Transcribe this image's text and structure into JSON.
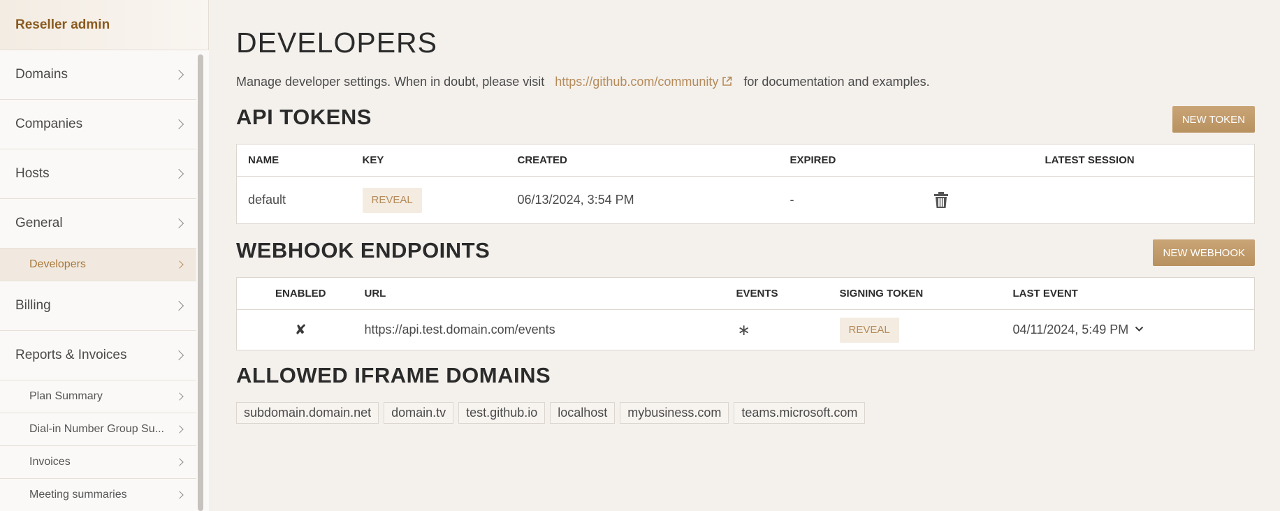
{
  "sidebar": {
    "header": "Reseller admin",
    "items": [
      {
        "label": "Domains"
      },
      {
        "label": "Companies"
      },
      {
        "label": "Hosts"
      },
      {
        "label": "General"
      },
      {
        "label": "Developers"
      },
      {
        "label": "Billing"
      },
      {
        "label": "Reports & Invoices"
      },
      {
        "label": "Plan Summary"
      },
      {
        "label": "Dial-in Number Group Su..."
      },
      {
        "label": "Invoices"
      },
      {
        "label": "Meeting summaries"
      }
    ]
  },
  "page": {
    "title": "DEVELOPERS",
    "intro_prefix": "Manage developer settings. When in doubt, please visit",
    "intro_link": "https://github.com/community",
    "intro_suffix": "for documentation and examples."
  },
  "api_tokens": {
    "title": "API TOKENS",
    "new_button": "NEW TOKEN",
    "columns": [
      "NAME",
      "KEY",
      "CREATED",
      "EXPIRED",
      "LATEST SESSION"
    ],
    "rows": [
      {
        "name": "default",
        "key": "REVEAL",
        "created": "06/13/2024, 3:54 PM",
        "expired": "-",
        "latest_session": ""
      }
    ]
  },
  "webhooks": {
    "title": "WEBHOOK ENDPOINTS",
    "new_button": "NEW WEBHOOK",
    "columns": [
      "ENABLED",
      "URL",
      "EVENTS",
      "SIGNING TOKEN",
      "LAST EVENT"
    ],
    "rows": [
      {
        "enabled": "✘",
        "url": "https://api.test.domain.com/events",
        "events": "∗",
        "signing_token": "REVEAL",
        "last_event": "04/11/2024, 5:49 PM"
      }
    ]
  },
  "iframe": {
    "title": "ALLOWED IFRAME DOMAINS",
    "domains": [
      "subdomain.domain.net",
      "domain.tv",
      "test.github.io",
      "localhost",
      "mybusiness.com",
      "teams.microsoft.com"
    ]
  },
  "icons": {
    "external_link": "external-link-icon",
    "delete": "trash-icon",
    "chevron": "chevron-right-icon",
    "dropdown": "chevron-down-icon"
  },
  "colors": {
    "accent": "#b58b5a",
    "brand": "#8a5a1f",
    "button": "#c0996a"
  }
}
